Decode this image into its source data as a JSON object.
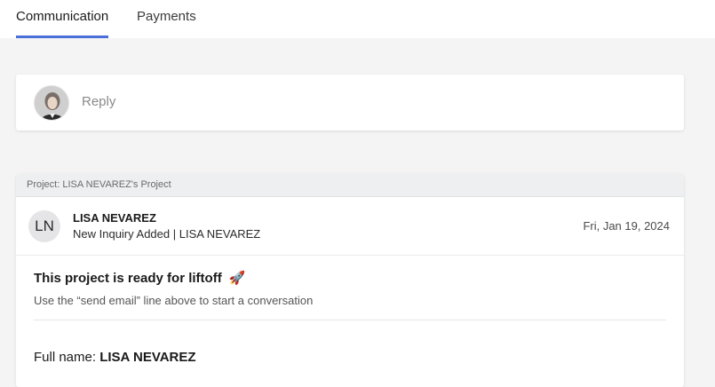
{
  "tabs": [
    {
      "label": "Communication",
      "active": true
    },
    {
      "label": "Payments",
      "active": false
    }
  ],
  "reply": {
    "placeholder": "Reply",
    "avatar_icon": "user-photo-avatar"
  },
  "project": {
    "header_label": "Project: LISA NEVAREZ's Project",
    "message": {
      "initials": "LN",
      "sender_name": "LISA NEVAREZ",
      "subject": "New Inquiry Added | LISA NEVAREZ",
      "date": "Fri, Jan 19, 2024"
    },
    "liftoff": {
      "title": "This project is ready for liftoff",
      "emoji": "🚀",
      "subtitle": "Use the “send email” line above to start a conversation"
    },
    "fullname": {
      "label": "Full name:",
      "value": "LISA NEVAREZ"
    }
  },
  "colors": {
    "accent": "#4a6fd8",
    "page_background": "#f4f4f4",
    "card_header_background": "#eeeff1"
  }
}
